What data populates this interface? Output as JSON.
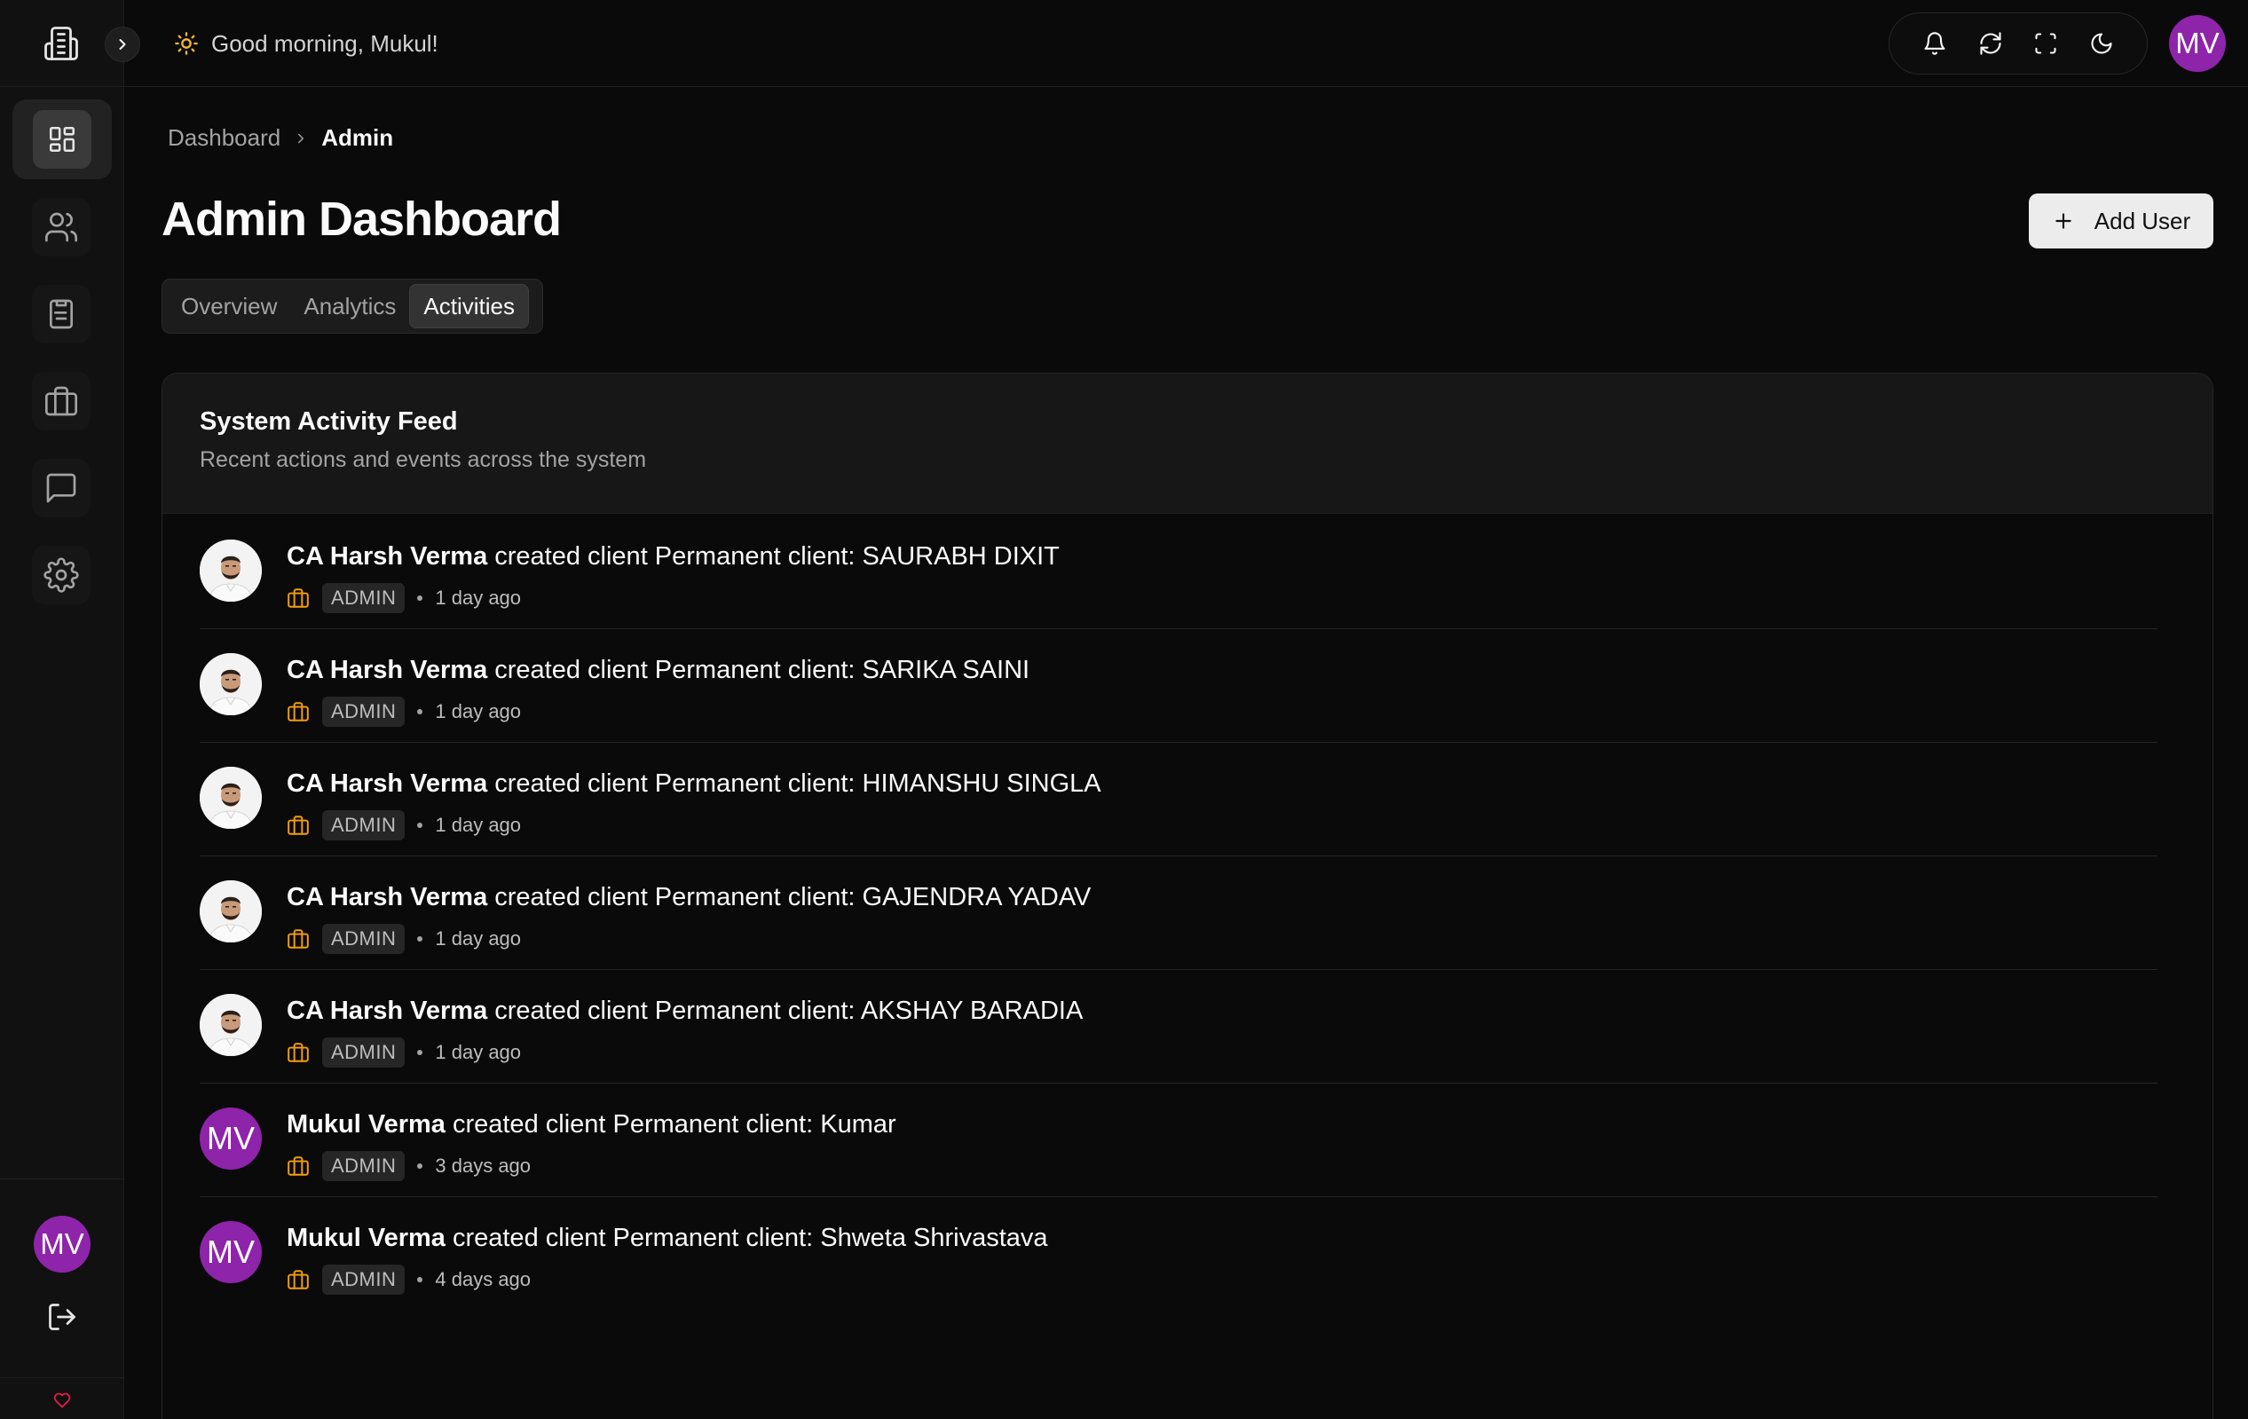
{
  "header": {
    "greeting": "Good morning, Mukul!",
    "user_initials": "MV"
  },
  "sidebar": {
    "items": [
      {
        "name": "dashboard",
        "icon": "layout-dashboard-icon",
        "active": true
      },
      {
        "name": "users",
        "icon": "users-icon"
      },
      {
        "name": "tasks",
        "icon": "clipboard-list-icon"
      },
      {
        "name": "clients",
        "icon": "briefcase-icon"
      },
      {
        "name": "messages",
        "icon": "message-square-icon"
      },
      {
        "name": "settings",
        "icon": "settings-icon"
      }
    ],
    "user_initials": "MV"
  },
  "breadcrumb": {
    "root": "Dashboard",
    "current": "Admin"
  },
  "page": {
    "title": "Admin Dashboard",
    "add_user_label": "Add User"
  },
  "tabs": [
    {
      "label": "Overview"
    },
    {
      "label": "Analytics"
    },
    {
      "label": "Activities",
      "active": true
    }
  ],
  "feed": {
    "title": "System Activity Feed",
    "subtitle": "Recent actions and events across the system",
    "items": [
      {
        "actor": "CA Harsh Verma",
        "action": " created client Permanent client: SAURABH DIXIT",
        "role": "ADMIN",
        "time": "1 day ago",
        "avatar": "photo"
      },
      {
        "actor": "CA Harsh Verma",
        "action": " created client Permanent client: SARIKA SAINI",
        "role": "ADMIN",
        "time": "1 day ago",
        "avatar": "photo"
      },
      {
        "actor": "CA Harsh Verma",
        "action": " created client Permanent client: HIMANSHU SINGLA",
        "role": "ADMIN",
        "time": "1 day ago",
        "avatar": "photo"
      },
      {
        "actor": "CA Harsh Verma",
        "action": " created client Permanent client: GAJENDRA YADAV",
        "role": "ADMIN",
        "time": "1 day ago",
        "avatar": "photo"
      },
      {
        "actor": "CA Harsh Verma",
        "action": " created client Permanent client: AKSHAY BARADIA",
        "role": "ADMIN",
        "time": "1 day ago",
        "avatar": "photo"
      },
      {
        "actor": "Mukul Verma",
        "action": " created client Permanent client: Kumar",
        "role": "ADMIN",
        "time": "3 days ago",
        "avatar": "MV"
      },
      {
        "actor": "Mukul Verma",
        "action": " created client Permanent client: Shweta Shrivastava",
        "role": "ADMIN",
        "time": "4 days ago",
        "avatar": "MV"
      }
    ]
  },
  "colors": {
    "accent_avatar": "#8e24aa",
    "briefcase_orange": "#f59e0b",
    "sun_yellow": "#f5b82e",
    "heart_red": "#e11d48"
  }
}
